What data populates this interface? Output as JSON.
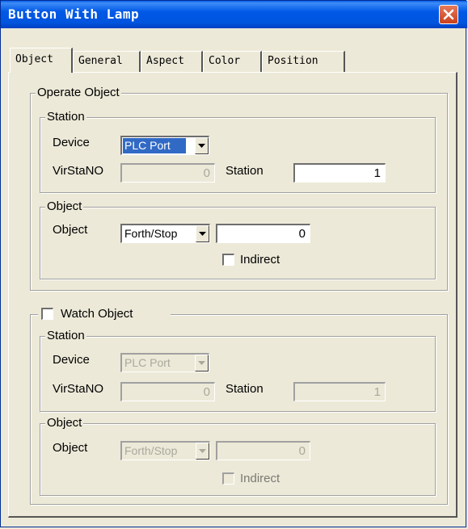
{
  "window": {
    "title": "Button With Lamp"
  },
  "tabs": [
    "Object",
    "General",
    "Aspect",
    "Color",
    "Position"
  ],
  "operate": {
    "legend": "Operate Object",
    "station": {
      "legend": "Station",
      "device_label": "Device",
      "device_value": "PLC Port",
      "virsta_label": "VirStaNO",
      "virsta_value": "0",
      "station_label": "Station",
      "station_value": "1"
    },
    "object": {
      "legend": "Object",
      "object_label": "Object",
      "object_value": "Forth/Stop",
      "address_value": "0",
      "indirect_label": "Indirect"
    }
  },
  "watch": {
    "legend": "Watch Object",
    "station": {
      "legend": "Station",
      "device_label": "Device",
      "device_value": "PLC Port",
      "virsta_label": "VirStaNO",
      "virsta_value": "0",
      "station_label": "Station",
      "station_value": "1"
    },
    "object": {
      "legend": "Object",
      "object_label": "Object",
      "object_value": "Forth/Stop",
      "address_value": "0",
      "indirect_label": "Indirect"
    }
  }
}
